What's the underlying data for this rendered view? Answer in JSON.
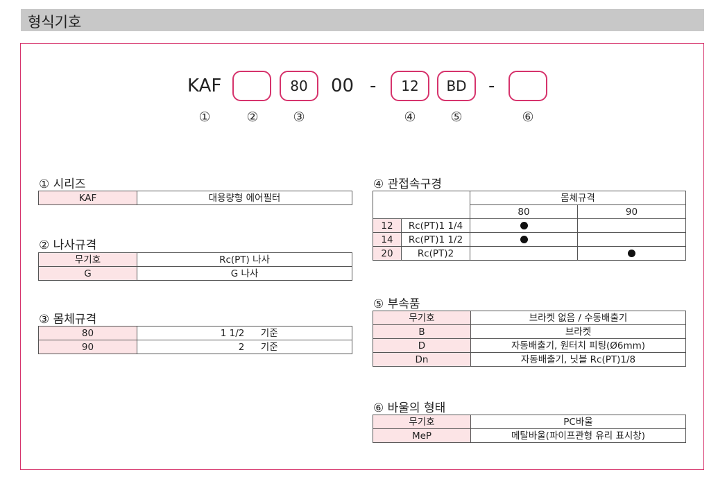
{
  "header": {
    "title": "형식기호"
  },
  "model": {
    "prefix": "KAF",
    "box1": "",
    "box2": "80",
    "mid": "00",
    "dash1": "-",
    "box3": "12",
    "box4": "BD",
    "dash2": "-",
    "box5": "",
    "markers": [
      "①",
      "②",
      "③",
      "④",
      "⑤",
      "⑥"
    ]
  },
  "series": {
    "title": "① 시리즈",
    "rows": [
      {
        "code": "KAF",
        "desc": "대용량형 에어필터"
      }
    ]
  },
  "thread": {
    "title": "② 나사규격",
    "rows": [
      {
        "code": "무기호",
        "desc": "Rc(PT) 나사"
      },
      {
        "code": "G",
        "desc": "G 나사"
      }
    ]
  },
  "body": {
    "title": "③ 몸체규격",
    "rows": [
      {
        "code": "80",
        "size": "1 1/2",
        "unit": "기준"
      },
      {
        "code": "90",
        "size": "2",
        "unit": "기준"
      }
    ]
  },
  "port": {
    "title": "④ 관접속구경",
    "group_header": "몸체규격",
    "columns": [
      "80",
      "90"
    ],
    "rows": [
      {
        "code": "12",
        "desc": "Rc(PT)1 1/4",
        "c80": true,
        "c90": false
      },
      {
        "code": "14",
        "desc": "Rc(PT)1 1/2",
        "c80": true,
        "c90": false
      },
      {
        "code": "20",
        "desc": "Rc(PT)2",
        "c80": false,
        "c90": true
      }
    ]
  },
  "accessory": {
    "title": "⑤ 부속품",
    "rows": [
      {
        "code": "무기호",
        "desc": "브라켓 없음 / 수동배출기"
      },
      {
        "code": "B",
        "desc": "브라켓"
      },
      {
        "code": "D",
        "desc": "자동배출기, 원터치 피팅(Ø6mm)"
      },
      {
        "code": "Dn",
        "desc": "자동배출기, 닛블 Rc(PT)1/8"
      }
    ]
  },
  "bowl": {
    "title": "⑥ 바울의 형태",
    "rows": [
      {
        "code": "무기호",
        "desc": "PC바울"
      },
      {
        "code": "MeP",
        "desc": "메탈바울(파이프관형 유리 표시창)"
      }
    ]
  }
}
